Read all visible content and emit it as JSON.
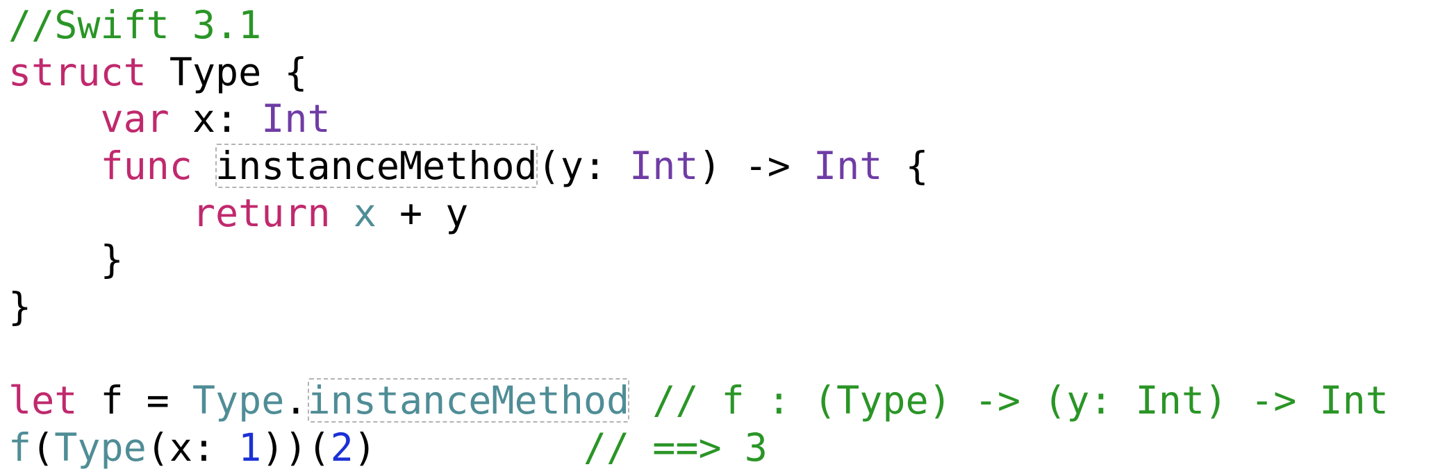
{
  "code": {
    "comment_header": "//Swift 3.1",
    "kw_struct": "struct",
    "type_name": "Type",
    "open_brace": "{",
    "close_brace": "}",
    "kw_var": "var",
    "var_name": "x:",
    "type_int": "Int",
    "kw_func": "func",
    "method_name": "instanceMethod",
    "params_open": "(y: ",
    "params_close": ") -> ",
    "kw_return": "return",
    "return_x": "x",
    "return_op": " + y",
    "kw_let": "let",
    "let_decl": " f = ",
    "type_ref": "Type",
    "dot": ".",
    "method_ref": "instanceMethod",
    "comment_signature": "// f : (Type) -> (y: Int) -> Int",
    "call_f": "f",
    "paren_open": "(",
    "call_type": "Type",
    "arg_label": "(x: ",
    "arg_value": "1",
    "paren_close_pair": "))",
    "paren_open2": "(",
    "arg_value2": "2",
    "paren_close": ")",
    "comment_result": "// ==> 3"
  },
  "colors": {
    "comment": "#2a9526",
    "keyword": "#c0296d",
    "type": "#6f3ca5",
    "identifier": "#4f8d96",
    "number": "#1c30d6",
    "plain": "#000000"
  }
}
